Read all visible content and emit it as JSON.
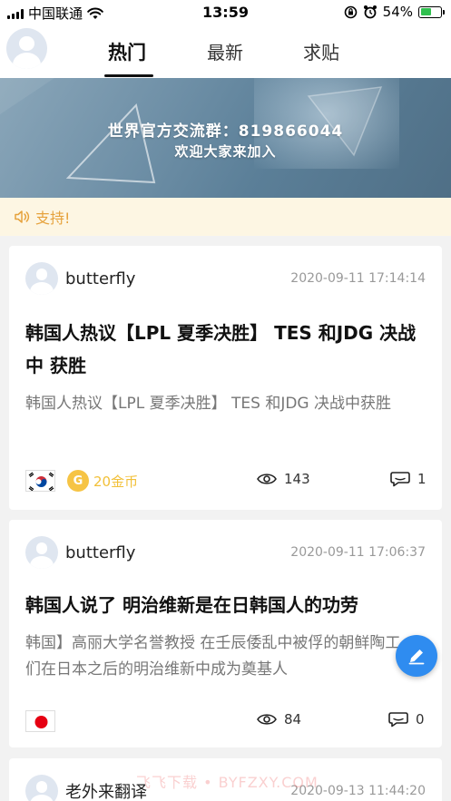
{
  "status_bar": {
    "carrier": "中国联通",
    "time": "13:59",
    "battery_percent": "54%",
    "battery_level": 0.54,
    "icons": [
      "signal-icon",
      "wifi-icon",
      "rotation-lock-icon",
      "alarm-icon",
      "battery-icon"
    ]
  },
  "nav": {
    "tabs": [
      {
        "label": "热门",
        "active": true
      },
      {
        "label": "最新",
        "active": false
      },
      {
        "label": "求贴",
        "active": false
      }
    ]
  },
  "banner": {
    "line1": "世界官方交流群：819866044",
    "line2": "欢迎大家来加入"
  },
  "notice": {
    "icon": "speaker-icon",
    "text": "支持!"
  },
  "posts": [
    {
      "author": "butterfly",
      "time": "2020-09-11 17:14:14",
      "title": "韩国人热议【LPL 夏季决胜】 TES 和JDG 决战中 获胜",
      "excerpt": "韩国人热议【LPL 夏季决胜】 TES 和JDG 决战中获胜",
      "flag": "south-korea",
      "coin_label": "G",
      "coin_text": "20金币",
      "views": "143",
      "comments": "1"
    },
    {
      "author": "butterfly",
      "time": "2020-09-11 17:06:37",
      "title": "韩国人说了 明治维新是在日韩国人的功劳",
      "excerpt": "韩国】高丽大学名誉教授 在壬辰倭乱中被俘的朝鲜陶工们在日本之后的明治维新中成为奠基人",
      "flag": "japan",
      "views": "84",
      "comments": "0"
    },
    {
      "author": "老外来翻译",
      "time": "2020-09-13 11:44:20"
    }
  ],
  "fab": {
    "icon": "edit-pencil-icon"
  },
  "watermark": "飞飞下载 • BYFZXY.COM",
  "colors": {
    "accent": "#2f8cf0",
    "notice_text": "#e6a23c",
    "notice_bg": "#fdf6e3",
    "coin": "#f6c445"
  }
}
